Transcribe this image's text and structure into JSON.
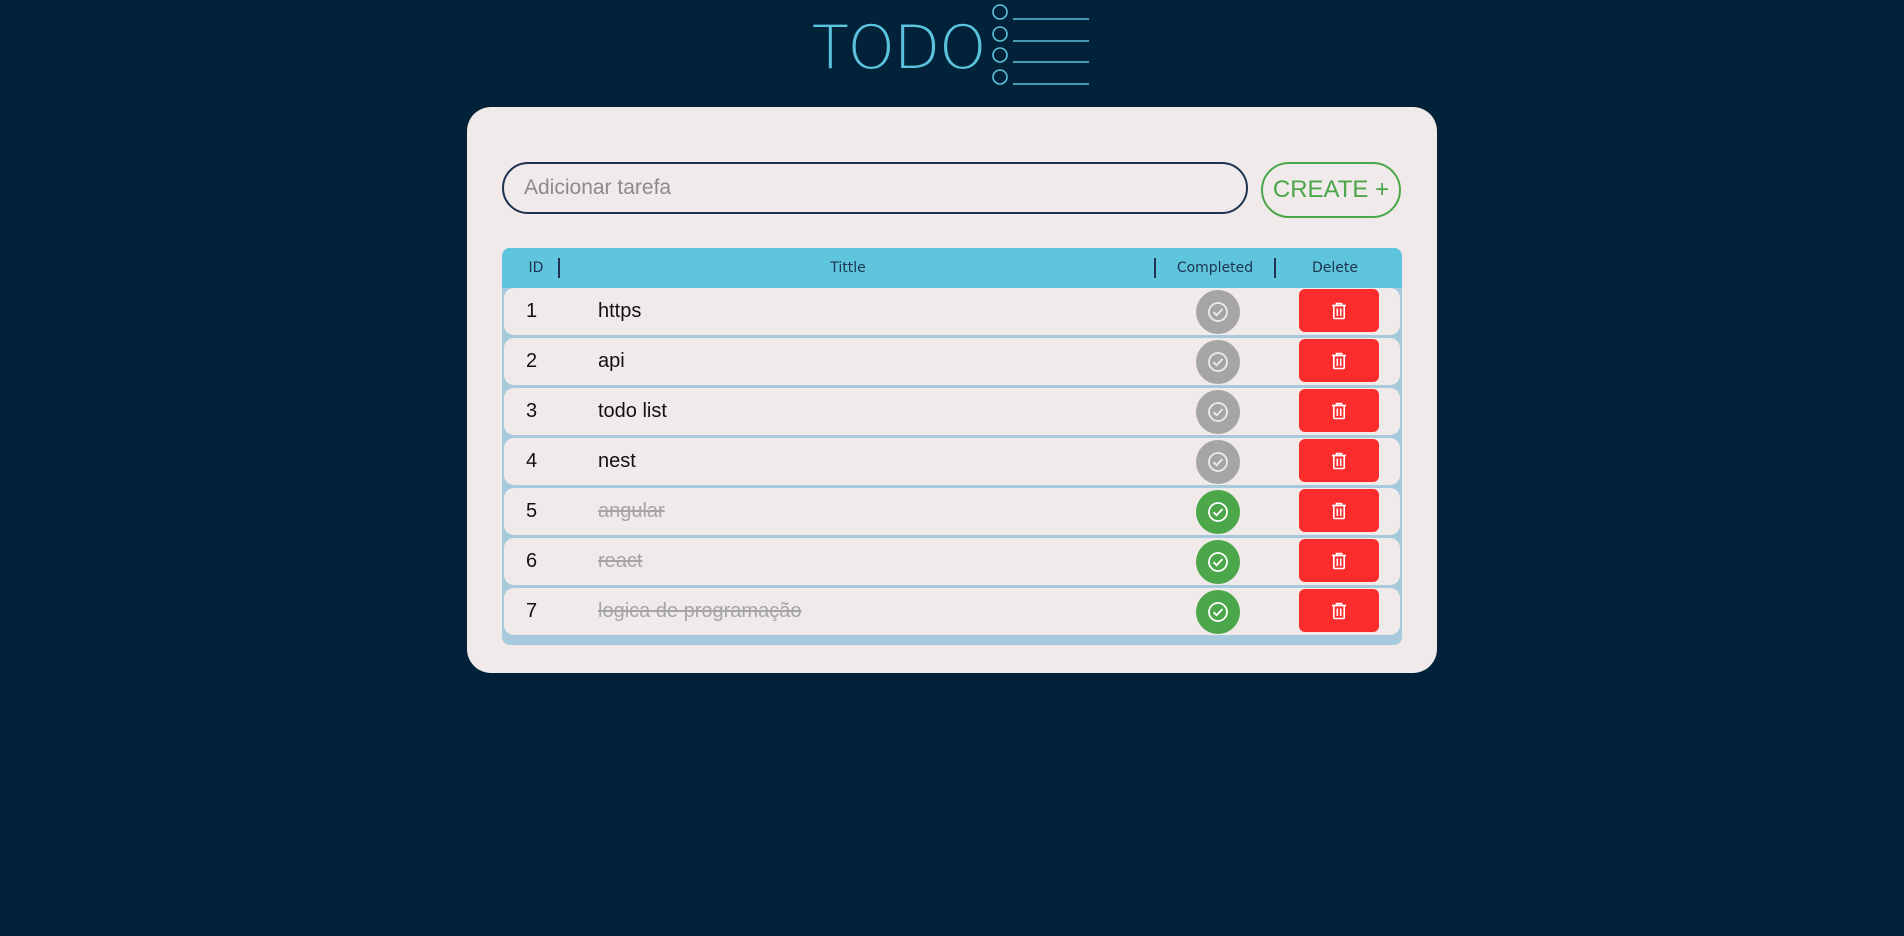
{
  "app": {
    "logo_text": "TODO",
    "accent_color": "#5bc4dc",
    "background_color": "#02223a"
  },
  "form": {
    "input_placeholder": "Adicionar tarefa",
    "input_value": "",
    "create_label": "CREATE +"
  },
  "table": {
    "headers": {
      "id": "ID",
      "title": "Tittle",
      "completed": "Completed",
      "delete": "Delete"
    },
    "rows": [
      {
        "id": "1",
        "title": "https",
        "completed": false
      },
      {
        "id": "2",
        "title": "api",
        "completed": false
      },
      {
        "id": "3",
        "title": "todo list",
        "completed": false
      },
      {
        "id": "4",
        "title": "nest",
        "completed": false
      },
      {
        "id": "5",
        "title": "angular",
        "completed": true
      },
      {
        "id": "6",
        "title": "react",
        "completed": true
      },
      {
        "id": "7",
        "title": "logica de programação",
        "completed": true
      }
    ],
    "icons": {
      "complete": "check-circle-icon",
      "delete": "trash-icon"
    },
    "colors": {
      "completed": "#4ca64a",
      "pending": "#a5a5a5",
      "delete": "#fb2c2c",
      "header": "#5ec5dc"
    }
  }
}
